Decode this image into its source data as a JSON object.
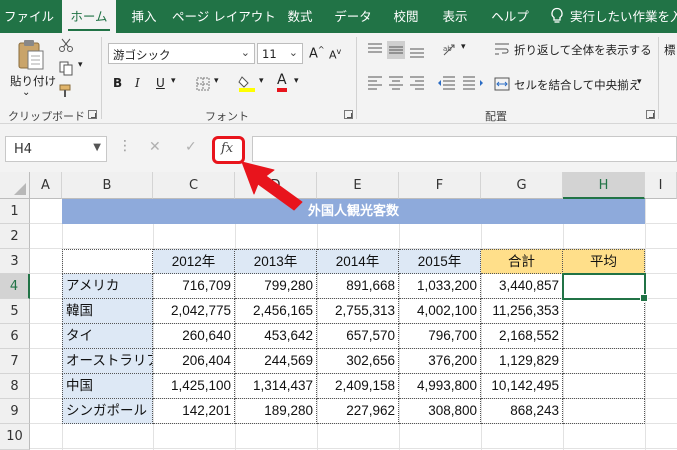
{
  "ribbon_tabs": [
    {
      "label": "ファイル"
    },
    {
      "label": "ホーム"
    },
    {
      "label": "挿入"
    },
    {
      "label": "ページ レイアウト"
    },
    {
      "label": "数式"
    },
    {
      "label": "データ"
    },
    {
      "label": "校閲"
    },
    {
      "label": "表示"
    },
    {
      "label": "ヘルプ"
    }
  ],
  "tell_me": "実行したい作業を入",
  "clipboard": {
    "paste_label": "貼り付け",
    "group_label": "クリップボード"
  },
  "font": {
    "name": "游ゴシック",
    "size": "11",
    "group_label": "フォント",
    "bold": "B",
    "italic": "I",
    "underline": "U",
    "grow": "A",
    "shrink": "A",
    "font_color_letter": "A"
  },
  "alignment": {
    "wrap_text": "折り返して全体を表示する",
    "merge_center": "セルを結合して中央揃え",
    "group_label": "配置"
  },
  "right_edge_label": "標",
  "formula_bar": {
    "name_box": "H4",
    "cancel": "✕",
    "enter": "✓",
    "fx": "fx",
    "formula": ""
  },
  "columns": [
    "A",
    "B",
    "C",
    "D",
    "E",
    "F",
    "G",
    "H",
    "I"
  ],
  "rows": [
    "1",
    "2",
    "3",
    "4",
    "5",
    "6",
    "7",
    "8",
    "9",
    "10"
  ],
  "selected_column": "H",
  "selected_row": "4",
  "sheet": {
    "title": "外国人観光客数",
    "headers": [
      "2012年",
      "2013年",
      "2014年",
      "2015年",
      "合計",
      "平均"
    ],
    "data": [
      {
        "label": "アメリカ",
        "values": [
          "716,709",
          "799,280",
          "891,668",
          "1,033,200",
          "3,440,857",
          ""
        ]
      },
      {
        "label": "韓国",
        "values": [
          "2,042,775",
          "2,456,165",
          "2,755,313",
          "4,002,100",
          "11,256,353",
          ""
        ]
      },
      {
        "label": "タイ",
        "values": [
          "260,640",
          "453,642",
          "657,570",
          "796,700",
          "2,168,552",
          ""
        ]
      },
      {
        "label": "オーストラリア",
        "values": [
          "206,404",
          "244,569",
          "302,656",
          "376,200",
          "1,129,829",
          ""
        ]
      },
      {
        "label": "中国",
        "values": [
          "1,425,100",
          "1,314,437",
          "2,409,158",
          "4,993,800",
          "10,142,495",
          ""
        ]
      },
      {
        "label": "シンガポール",
        "values": [
          "142,201",
          "189,280",
          "227,962",
          "308,800",
          "868,243",
          ""
        ]
      }
    ]
  },
  "colors": {
    "excel_green": "#217346",
    "title_blue": "#8eaadb",
    "header_blue": "#dde8f5",
    "header_yellow": "#ffdf8a",
    "highlight_red": "#e8141c"
  }
}
